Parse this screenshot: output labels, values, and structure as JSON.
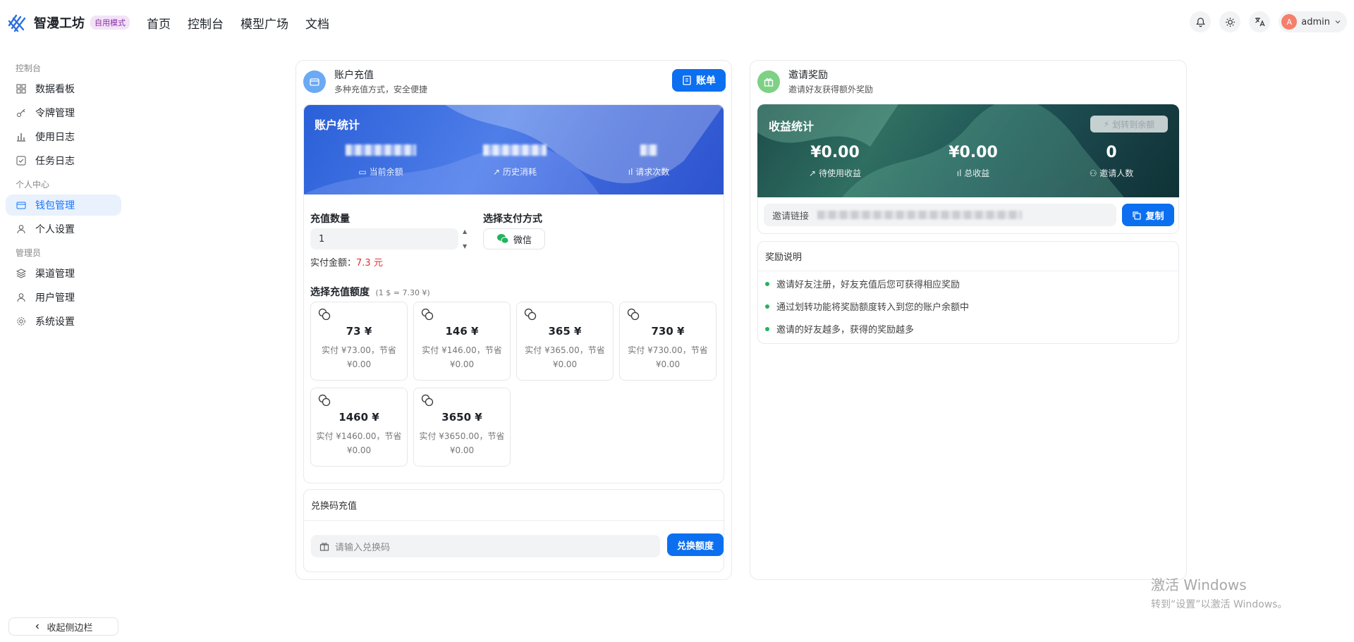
{
  "header": {
    "brand": "智漫工坊",
    "mode_badge": "自用模式",
    "nav": [
      "首页",
      "控制台",
      "模型广场",
      "文档"
    ],
    "user": {
      "avatar_letter": "A",
      "name": "admin"
    }
  },
  "sidebar": {
    "groups": [
      {
        "title": "控制台",
        "items": [
          {
            "label": "数据看板",
            "icon": "grid-icon"
          },
          {
            "label": "令牌管理",
            "icon": "key-icon"
          },
          {
            "label": "使用日志",
            "icon": "bar-chart-icon"
          },
          {
            "label": "任务日志",
            "icon": "checkbox-icon"
          }
        ]
      },
      {
        "title": "个人中心",
        "items": [
          {
            "label": "钱包管理",
            "icon": "wallet-icon",
            "active": true
          },
          {
            "label": "个人设置",
            "icon": "user-icon"
          }
        ]
      },
      {
        "title": "管理员",
        "items": [
          {
            "label": "渠道管理",
            "icon": "layers-icon"
          },
          {
            "label": "用户管理",
            "icon": "user-icon"
          },
          {
            "label": "系统设置",
            "icon": "gear-icon"
          }
        ]
      }
    ],
    "collapse_label": "收起侧边栏"
  },
  "recharge": {
    "title": "账户充值",
    "subtitle": "多种充值方式，安全便捷",
    "bill_button": "账单",
    "stats_title": "账户统计",
    "stats": [
      {
        "label": "当前余额"
      },
      {
        "label": "历史消耗"
      },
      {
        "label": "请求次数"
      }
    ],
    "quantity_label": "充值数量",
    "quantity_value": "1",
    "pay_label": "选择支付方式",
    "pay_method": "微信",
    "actual_label": "实付金额：",
    "actual_value": "7.3 元",
    "amount_label": "选择充值额度",
    "rate_note": "(1 $ = 7.30 ¥)",
    "amounts": [
      {
        "amount": "73 ¥",
        "desc": "实付 ¥73.00，节省 ¥0.00"
      },
      {
        "amount": "146 ¥",
        "desc": "实付 ¥146.00，节省 ¥0.00"
      },
      {
        "amount": "365 ¥",
        "desc": "实付 ¥365.00，节省 ¥0.00"
      },
      {
        "amount": "730 ¥",
        "desc": "实付 ¥730.00，节省 ¥0.00"
      },
      {
        "amount": "1460 ¥",
        "desc": "实付 ¥1460.00，节省 ¥0.00"
      },
      {
        "amount": "3650 ¥",
        "desc": "实付 ¥3650.00，节省 ¥0.00"
      }
    ],
    "redeem_title": "兑换码充值",
    "redeem_placeholder": "请输入兑换码",
    "redeem_button": "兑换额度"
  },
  "invite": {
    "title": "邀请奖励",
    "subtitle": "邀请好友获得额外奖励",
    "stats_title": "收益统计",
    "transfer_button": "划转到余额",
    "stats": [
      {
        "value": "¥0.00",
        "label": "待使用收益"
      },
      {
        "value": "¥0.00",
        "label": "总收益"
      },
      {
        "value": "0",
        "label": "邀请人数"
      }
    ],
    "link_label": "邀请链接",
    "copy_button": "复制",
    "rules_title": "奖励说明",
    "rules": [
      "邀请好友注册，好友充值后您可获得相应奖励",
      "通过划转功能将奖励额度转入到您的账户余额中",
      "邀请的好友越多，获得的奖励越多"
    ]
  },
  "watermark": {
    "line1": "激活 Windows",
    "line2": "转到“设置”以激活 Windows。"
  },
  "colors": {
    "accent": "#0b6ff0",
    "active_bg": "#e9f1fd",
    "price_red": "#e5322d",
    "green": "#22b35e"
  }
}
